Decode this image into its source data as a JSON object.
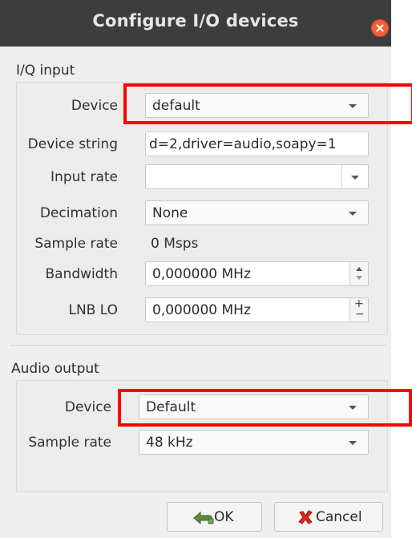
{
  "window": {
    "title": "Configure I/O devices"
  },
  "iq_input": {
    "section_label": "I/Q input",
    "device_label": "Device",
    "device_value": "default",
    "device_string_label": "Device string",
    "device_string_value": "d=2,driver=audio,soapy=1",
    "input_rate_label": "Input rate",
    "input_rate_value": "",
    "decimation_label": "Decimation",
    "decimation_value": "None",
    "sample_rate_label": "Sample rate",
    "sample_rate_value": "0 Msps",
    "bandwidth_label": "Bandwidth",
    "bandwidth_value": "0,000000 MHz",
    "lnb_lo_label": "LNB LO",
    "lnb_lo_value": "0,000000 MHz"
  },
  "audio_output": {
    "section_label": "Audio output",
    "device_label": "Device",
    "device_value": "Default",
    "sample_rate_label": "Sample rate",
    "sample_rate_value": "48 kHz"
  },
  "buttons": {
    "ok_label": "OK",
    "cancel_label": "Cancel"
  },
  "icons": {
    "close": "close-icon",
    "ok": "ok-icon",
    "cancel": "cancel-icon"
  },
  "colors": {
    "highlight": "#ff0000",
    "titlebar": "#3d3d3d",
    "close": "#f0623b"
  }
}
